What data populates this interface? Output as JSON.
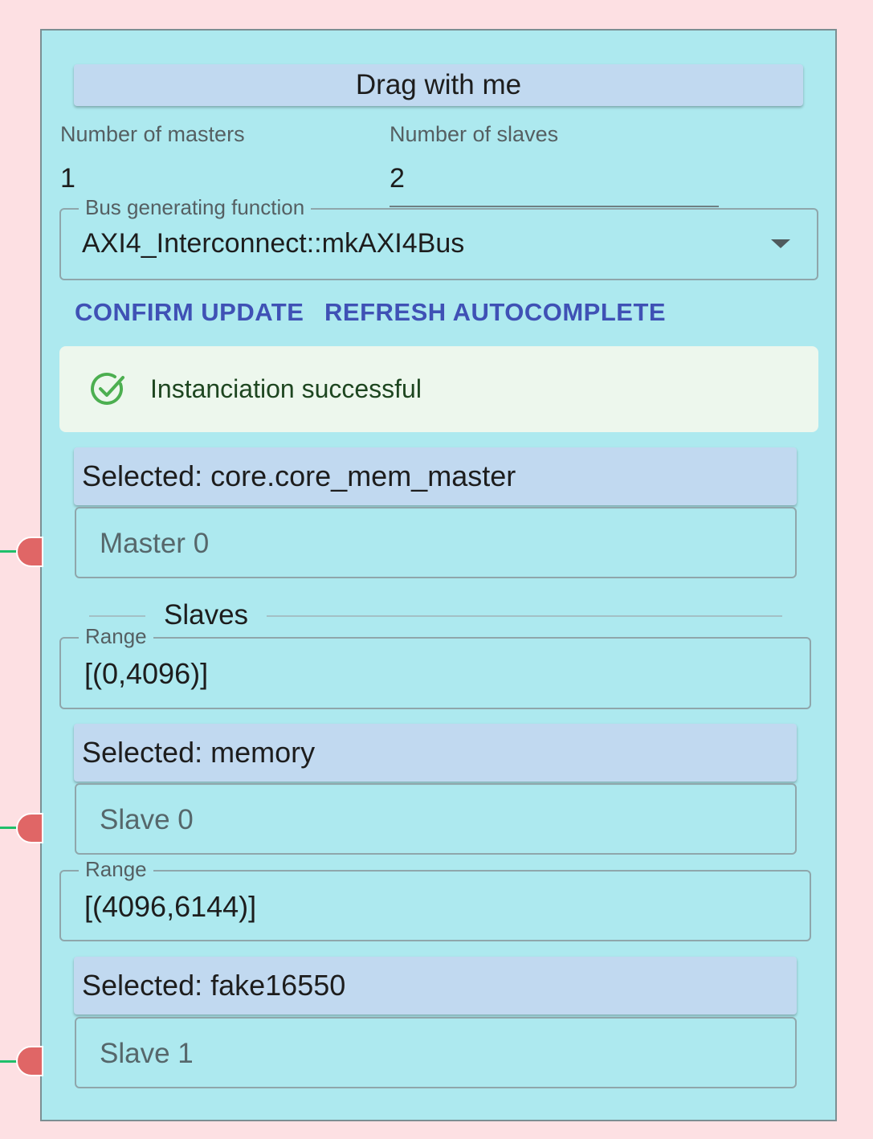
{
  "header": {
    "drag_label": "Drag with me"
  },
  "config": {
    "masters_label": "Number of masters",
    "masters_value": "1",
    "slaves_label": "Number of slaves",
    "slaves_value": "2",
    "bus_fn_label": "Bus generating function",
    "bus_fn_value": "AXI4_Interconnect::mkAXI4Bus"
  },
  "actions": {
    "confirm_label": "CONFIRM UPDATE",
    "refresh_label": "REFRESH AUTOCOMPLETE"
  },
  "alert": {
    "text": "Instanciation successful",
    "icon": "check-circle-icon",
    "color": "#4caf50"
  },
  "master": {
    "selected_label": "Selected: core.core_mem_master",
    "placeholder": "Master 0"
  },
  "slaves_section": {
    "title": "Slaves"
  },
  "slaves": [
    {
      "range_label": "Range",
      "range_value": "[(0,4096)]",
      "selected_label": "Selected: memory",
      "placeholder": "Slave 0"
    },
    {
      "range_label": "Range",
      "range_value": "[(4096,6144)]",
      "selected_label": "Selected: fake16550",
      "placeholder": "Slave 1"
    }
  ],
  "colors": {
    "accent": "#3f51b5",
    "panel": "#ade9ef",
    "handle": "#e06666",
    "wire": "#1fbf6a",
    "background": "#fde0e3"
  }
}
